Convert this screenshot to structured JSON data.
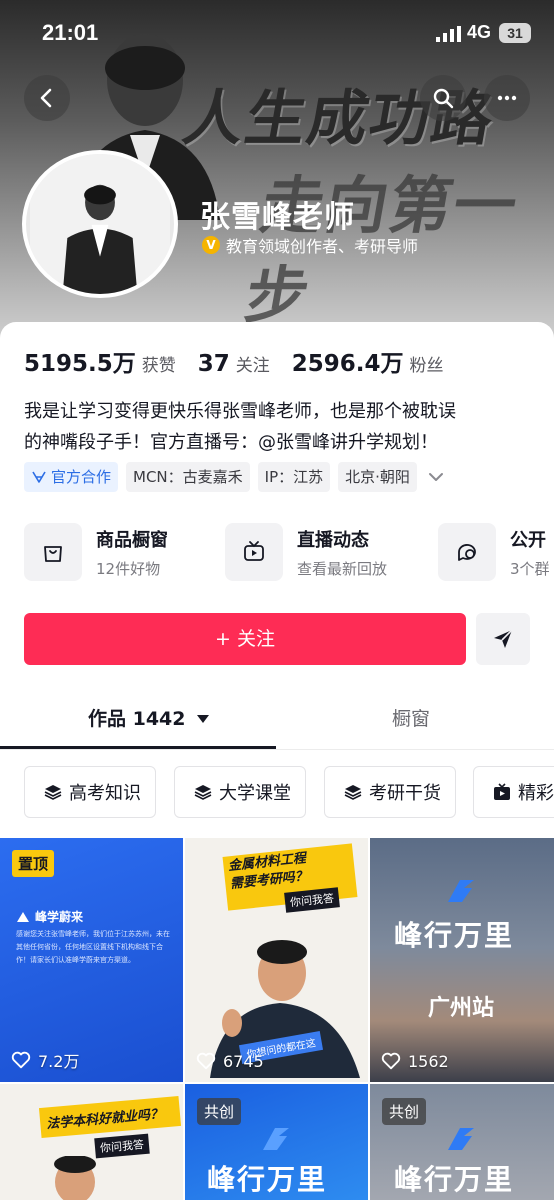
{
  "status_bar": {
    "time": "21:01",
    "network": "4G",
    "battery": "31"
  },
  "banner": {
    "slogan_line1": "人生成功路",
    "slogan_line2": "走向第一步"
  },
  "profile": {
    "name": "张雪峰老师",
    "verification_badge": "V",
    "verification": "教育领域创作者、考研导师"
  },
  "stats": [
    {
      "value": "5195.5万",
      "label": "获赞"
    },
    {
      "value": "37",
      "label": "关注"
    },
    {
      "value": "2596.4万",
      "label": "粉丝"
    }
  ],
  "bio": {
    "line1": "我是让学习变得更快乐得张雪峰老师，也是那个被耽误",
    "line2": "的神嘴段子手！官方直播号：@张雪峰讲升学规划！"
  },
  "tags": [
    "官方合作",
    "MCN：古麦嘉禾",
    "IP：江苏",
    "北京·朝阳"
  ],
  "services": [
    {
      "title": "商品橱窗",
      "subtitle": "12件好物",
      "icon": "shop-bag-icon"
    },
    {
      "title": "直播动态",
      "subtitle": "查看最新回放",
      "icon": "live-tv-icon"
    },
    {
      "title": "公开",
      "subtitle": "3个群",
      "icon": "chat-group-icon"
    }
  ],
  "actions": {
    "follow_label": "+ 关注"
  },
  "tabs": {
    "works": "作品 1442",
    "showcase": "橱窗"
  },
  "collections": [
    "高考知识",
    "大学课堂",
    "考研干货",
    "精彩"
  ],
  "videos": [
    {
      "badge": "置顶",
      "likes": "7.2万",
      "brand": "峰学蔚来",
      "caption": "感谢您关注张雪峰老师，我们位于江苏苏州，未在其他任何省份，任何地区设置线下机构和线下合作！请家长们认准峰学蔚来官方渠道。"
    },
    {
      "badge": "",
      "likes": "6745",
      "title_line1": "金属材料工程",
      "title_line2": "需要考研吗？",
      "tag": "你问我答",
      "sticker": "你想问的都在这"
    },
    {
      "badge": "",
      "likes": "1562",
      "brand": "峰行万里",
      "subtitle": "广州站"
    },
    {
      "badge": "",
      "title_line1": "法学本科好就业吗？",
      "tag": "你问我答"
    },
    {
      "badge": "共创",
      "brand": "峰行万里"
    },
    {
      "badge": "共创",
      "brand": "峰行万里"
    }
  ]
}
